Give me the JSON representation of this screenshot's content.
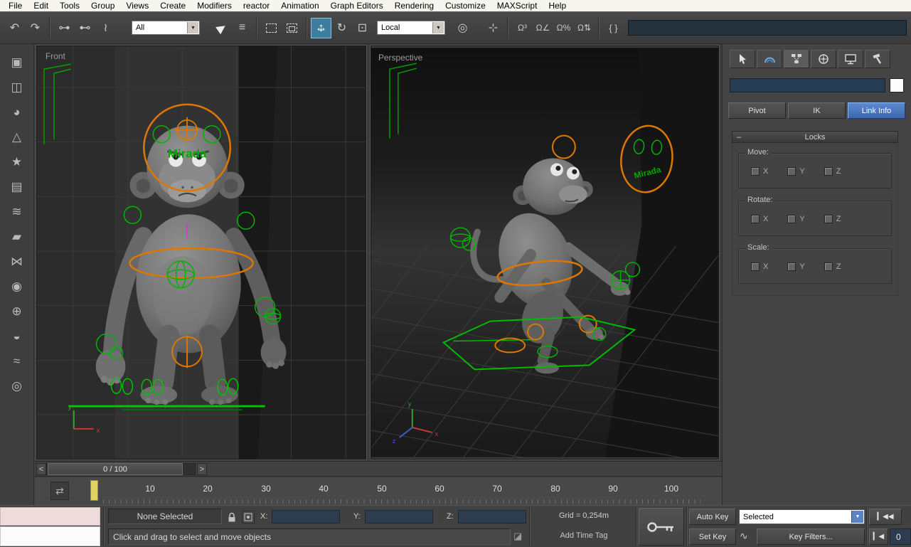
{
  "menu_bar": {
    "items": [
      "File",
      "Edit",
      "Tools",
      "Group",
      "Views",
      "Create",
      "Modifiers",
      "reactor",
      "Animation",
      "Graph Editors",
      "Rendering",
      "Customize",
      "MAXScript",
      "Help"
    ]
  },
  "icons": {
    "undo": "↶",
    "redo": "↷",
    "select_link": "⊶",
    "unlink": "⊷",
    "bind_spacewarp": "≀",
    "select_arrow": "▶",
    "select_by_name": "≡",
    "rotate": "↻",
    "scale": "⊡",
    "pivot_center": "◎",
    "manipulate": "⊹",
    "snap_3d": "Ω³",
    "snap_angle": "Ω∠",
    "snap_percent": "Ω%",
    "snap_spinner": "Ω⇅",
    "named_sets": "{ }",
    "move_h": "↔",
    "move_v": "↕",
    "track_left": "<",
    "track_right": ">",
    "trackbar_toggle": "⇄",
    "go_to_start": "▎◀◀",
    "step_back": "▎◀",
    "key_curve": "∿",
    "combo_arrow": "▼",
    "prompt_side": "◪",
    "left_tools": [
      "▣",
      "◫",
      "◕",
      "△",
      "★",
      "▤",
      "≋",
      "▰",
      "⋈",
      "◉",
      "⊕",
      "◒",
      "≈",
      "◎"
    ]
  },
  "main_toolbar": {
    "selection_filter": "All",
    "coordinate_system": "Local",
    "named_selection_value": ""
  },
  "viewports": {
    "front": {
      "label": "Front",
      "rig_name": "Mirada",
      "axis_x": "x",
      "axis_y": "y"
    },
    "perspective": {
      "label": "Perspective",
      "rig_name": "Mirada",
      "axis_x": "x",
      "axis_y": "y",
      "axis_z": "z"
    }
  },
  "command_panel": {
    "object_name_value": "",
    "pivot_button": "Pivot",
    "ik_button": "IK",
    "link_info_button": "Link Info",
    "locks_rollout": {
      "collapse_glyph": "–",
      "title": "Locks",
      "move_label": "Move:",
      "rotate_label": "Rotate:",
      "scale_label": "Scale:",
      "axis_x": "X",
      "axis_y": "Y",
      "axis_z": "Z"
    }
  },
  "track_bar": {
    "position_label": "0 / 100"
  },
  "timeline": {
    "ticks": [
      "10",
      "20",
      "30",
      "40",
      "50",
      "60",
      "70",
      "80",
      "90",
      "100"
    ]
  },
  "status_bar": {
    "selection_status": "None Selected",
    "x_label": "X:",
    "y_label": "Y:",
    "z_label": "Z:",
    "x_value": "",
    "y_value": "",
    "z_value": "",
    "grid_label": "Grid = 0,254m",
    "prompt": "Click and drag to select and move objects",
    "add_time_tag": "Add Time Tag",
    "auto_key_button": "Auto Key",
    "set_key_button": "Set Key",
    "key_mode": "Selected",
    "key_filters_button": "Key Filters...",
    "frame_value": "0"
  }
}
